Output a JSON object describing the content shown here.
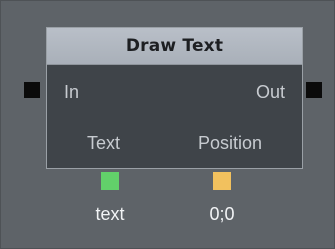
{
  "node": {
    "title": "Draw Text",
    "ports": {
      "in_label": "In",
      "out_label": "Out",
      "text_label": "Text",
      "position_label": "Position"
    },
    "values": {
      "text": "text",
      "position": "0;0"
    }
  },
  "colors": {
    "text_port": "#62d06a",
    "position_port": "#f2c15e",
    "flow_port": "#0b0b0b"
  }
}
